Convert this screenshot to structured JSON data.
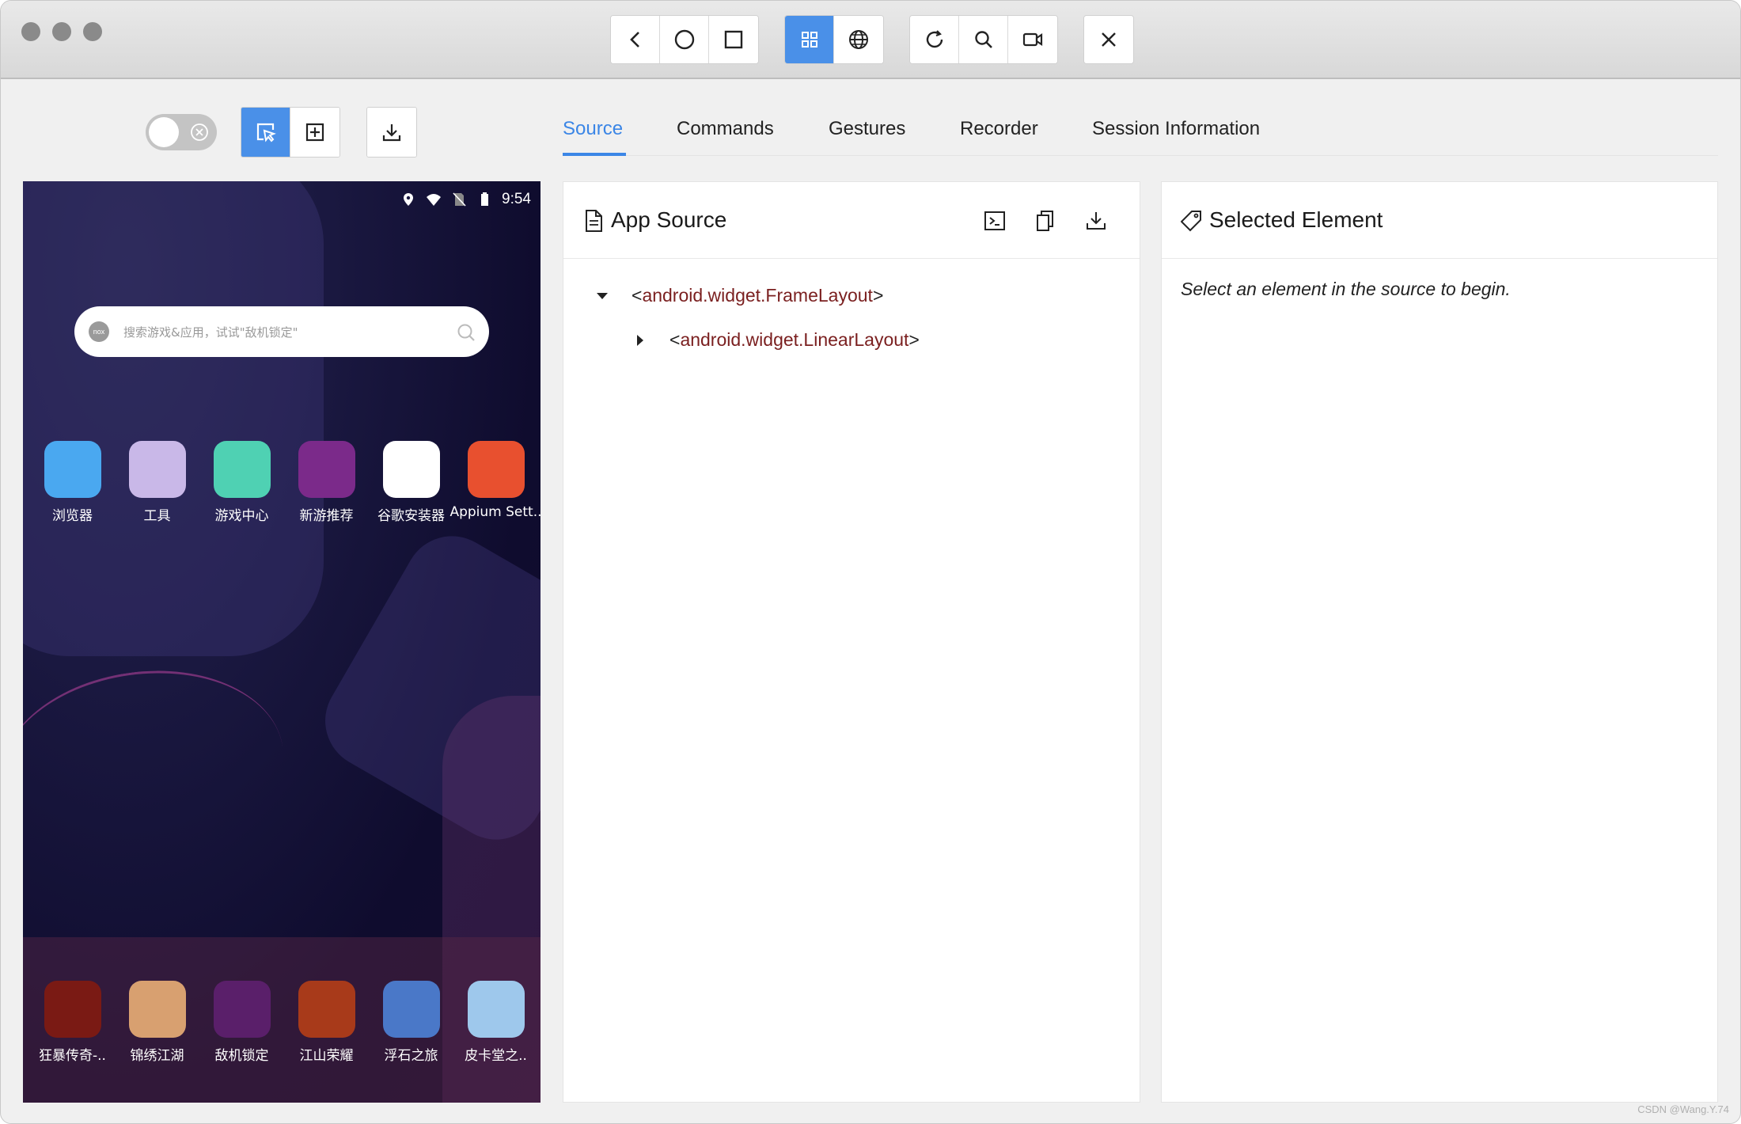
{
  "titlebar": {
    "nav_buttons": [
      "back-icon",
      "home-icon",
      "square-icon"
    ],
    "mode_buttons": [
      "grid-icon",
      "globe-icon"
    ],
    "action_buttons": [
      "refresh-icon",
      "search-icon",
      "video-icon"
    ],
    "close_button": "close-icon"
  },
  "tabs": {
    "items": [
      {
        "label": "Source",
        "active": true
      },
      {
        "label": "Commands",
        "active": false
      },
      {
        "label": "Gestures",
        "active": false
      },
      {
        "label": "Recorder",
        "active": false
      },
      {
        "label": "Session Information",
        "active": false
      }
    ]
  },
  "phone": {
    "status_time": "9:54",
    "search_placeholder": "搜索游戏&应用，试试\"敌机锁定\"",
    "search_logo": "nox",
    "apps_row1": [
      {
        "label": "浏览器",
        "color": "#4aa8f0"
      },
      {
        "label": "工具",
        "color": "#c9b8e8"
      },
      {
        "label": "游戏中心",
        "color": "#4fd1b3"
      },
      {
        "label": "新游推荐",
        "color": "#7b2a8a"
      },
      {
        "label": "谷歌安装器",
        "color": "#ffffff"
      },
      {
        "label": "Appium Sett..",
        "color": "#e8502f"
      }
    ],
    "apps_row2": [
      {
        "label": "狂暴传奇-..",
        "color": "#7a1a14"
      },
      {
        "label": "锦绣江湖",
        "color": "#d8a070"
      },
      {
        "label": "敌机锁定",
        "color": "#5a1f6a"
      },
      {
        "label": "江山荣耀",
        "color": "#a83a1a"
      },
      {
        "label": "浮石之旅",
        "color": "#4a78c8"
      },
      {
        "label": "皮卡堂之..",
        "color": "#9ec8ec"
      }
    ]
  },
  "app_source": {
    "title": "App Source",
    "tree": [
      {
        "open": "<",
        "tag": "android.widget.FrameLayout",
        "close": ">",
        "expanded": true,
        "depth": 0
      },
      {
        "open": "<",
        "tag": "android.widget.LinearLayout",
        "close": ">",
        "expanded": false,
        "depth": 1
      }
    ]
  },
  "selected_element": {
    "title": "Selected Element",
    "empty_message": "Select an element in the source to begin."
  },
  "watermark": "CSDN @Wang.Y.74",
  "colors": {
    "accent": "#3b86e6",
    "active_button": "#4a90e8",
    "tag_text": "#7a1f1f"
  }
}
